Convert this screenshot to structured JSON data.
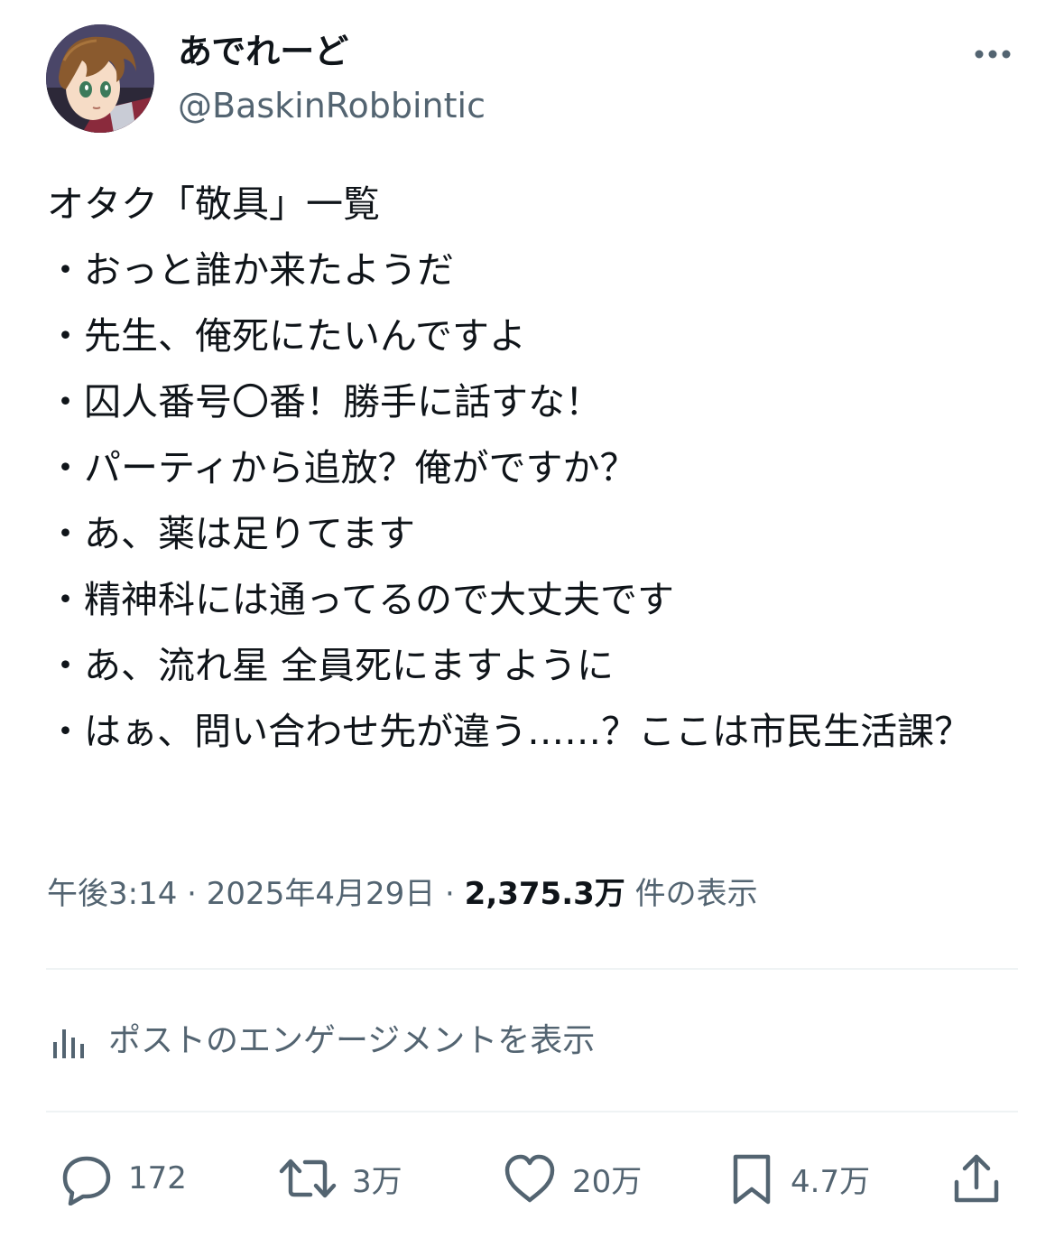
{
  "author": {
    "display_name": "あでれーど",
    "handle": "@BaskinRobbintic"
  },
  "tweet": {
    "text": "オタク「敬具」一覧\n・おっと誰か来たようだ\n・先生、俺死にたいんですよ\n・囚人番号〇番！勝手に話すな！\n・パーティから追放？俺がですか？\n・あ、薬は足りてます\n・精神科には通ってるので大丈夫です\n・あ、流れ星 全員死にますように\n・はぁ、問い合わせ先が違う……？ここは市民生活課？",
    "time": "午後3:14",
    "separator": "·",
    "date": "2025年4月29日",
    "views_count": "2,375.3万",
    "views_label": "件の表示"
  },
  "engagement": {
    "label": "ポストのエンゲージメントを表示"
  },
  "actions": {
    "reply_count": "172",
    "retweet_count": "3万",
    "like_count": "20万",
    "bookmark_count": "4.7万"
  },
  "icons": {
    "avatar": "anime-character-avatar",
    "more": "more-horizontal-icon",
    "engagement": "bar-chart-icon",
    "reply": "speech-bubble-icon",
    "retweet": "retweet-arrows-icon",
    "like": "heart-icon",
    "bookmark": "bookmark-icon",
    "share": "share-upload-icon"
  },
  "colors": {
    "text_primary": "#0f1419",
    "text_secondary": "#536471",
    "divider": "#eff3f4"
  }
}
